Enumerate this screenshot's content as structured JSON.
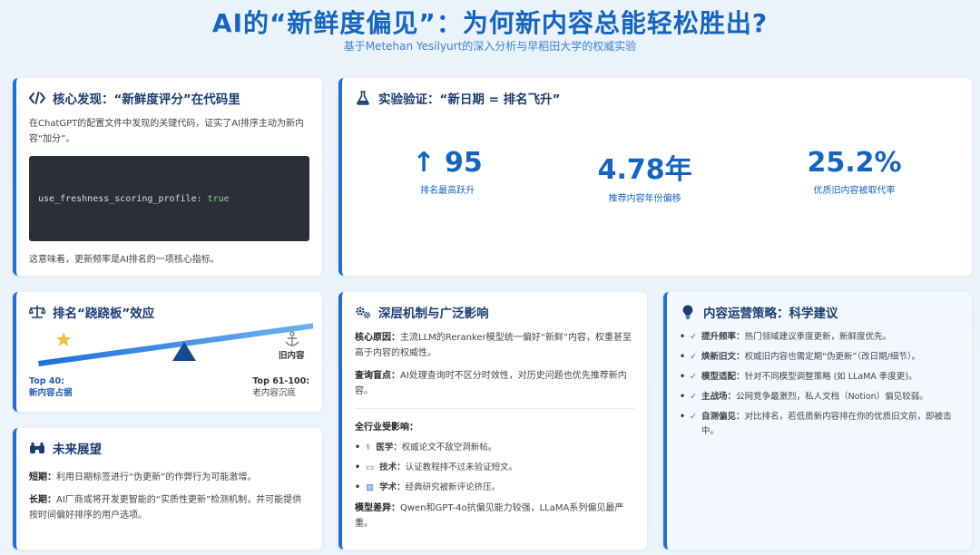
{
  "header": {
    "title": "AI的“新鲜度偏见”：为何新内容总能轻松胜出?",
    "subtitle": "基于Metehan Yesilyurt的深入分析与早稻田大学的权威实验"
  },
  "core": {
    "title": "核心发现：“新鲜度评分”在代码里",
    "desc": "在ChatGPT的配置文件中发现的关键代码，证实了AI排序主动为新内容“加分”。",
    "code_key": "use_freshness_scoring_profile:",
    "code_value": "true",
    "note": "这意味着，更新频率是AI排名的一项核心指标。"
  },
  "experiment": {
    "title": "实验验证：“新日期 = 排名飞升”",
    "stats": [
      {
        "value": "↑ 95",
        "label": "排名最高跃升"
      },
      {
        "value": "4.78年",
        "label": "推荐内容年份偏移"
      },
      {
        "value": "25.2%",
        "label": "优质旧内容被取代率"
      }
    ]
  },
  "seesaw": {
    "title": "排名“跷跷板”效应",
    "old_label": "旧内容",
    "left_head": "Top 40:",
    "left_sub": "新内容占据",
    "right_head": "Top 61-100:",
    "right_sub": "老内容沉底"
  },
  "future": {
    "title": "未来展望",
    "items": [
      {
        "head": "短期：",
        "text": "利用日期标签进行“伪更新”的作弊行为可能激增。"
      },
      {
        "head": "长期：",
        "text": "AI厂商或将开发更智能的“实质性更新”检测机制，并可能提供按时间偏好排序的用户选项。"
      }
    ]
  },
  "mechanism": {
    "title": "深层机制与广泛影响",
    "items": [
      {
        "head": "核心原因：",
        "text": "主流LLM的Reranker模型统一偏好“新鲜”内容，权重甚至高于内容的权威性。"
      },
      {
        "head": "查询盲点：",
        "text": "AI处理查询时不区分时效性，对历史问题也优先推荐新内容。"
      }
    ],
    "industry_title": "全行业受影响：",
    "industry": [
      {
        "icon": "⚕",
        "head": "医学：",
        "text": "权威论文不敌空洞新帖。"
      },
      {
        "icon": "▭",
        "head": "技术：",
        "text": "认证教程排不过未验证短文。"
      },
      {
        "icon": "▥",
        "head": "学术：",
        "text": "经典研究被新评论挤压。"
      }
    ],
    "diff_head": "模型差异：",
    "diff_text": "Qwen和GPT-4o抗偏见能力较强，LLaMA系列偏见最严重。"
  },
  "strategy": {
    "title": "内容运营策略：科学建议",
    "items": [
      {
        "head": "提升频率：",
        "text": "热门领域建议季度更新，新鲜度优先。"
      },
      {
        "head": "焕新旧文：",
        "text": "权威旧内容也需定期“伪更新”（改日期/细节）。"
      },
      {
        "head": "模型适配：",
        "text": "针对不同模型调整策略 (如 LLaMA 季度更)。"
      },
      {
        "head": "主战场：",
        "text": "公网竞争最激烈，私人文档（Notion）偏见较弱。"
      },
      {
        "head": "自测偏见：",
        "text": "对比排名，若低质新内容排在你的优质旧文前，即被击中。"
      }
    ]
  },
  "colors": {
    "accent": "#1e6fd9",
    "title": "#1565c0",
    "code_bg": "#2b2f38"
  }
}
